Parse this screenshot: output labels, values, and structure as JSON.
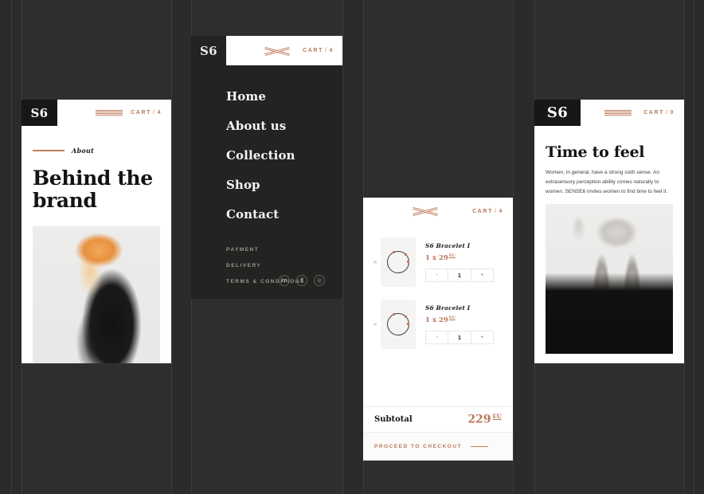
{
  "brand": {
    "logo": "S6",
    "name": "SENSE6"
  },
  "colors": {
    "copper": "#b9775a",
    "dark": "#232322",
    "logo_black": "#171716",
    "page_bg": "#2b2b2a"
  },
  "panel_about": {
    "logo": "S6",
    "hamburger_icon": "hamburger-icon",
    "cart_label": "CART",
    "cart_separator": "/",
    "cart_count": "4",
    "eyebrow": "About",
    "headline": "Behind the brand",
    "photo_alt": "woman-in-black-coat-photo"
  },
  "panel_menu": {
    "logo": "S6",
    "close_icon": "close-icon",
    "cart_label": "CART",
    "cart_separator": "/",
    "cart_count": "4",
    "nav": [
      {
        "label": "Home"
      },
      {
        "label": "About us"
      },
      {
        "label": "Collection"
      },
      {
        "label": "Shop"
      },
      {
        "label": "Contact"
      }
    ],
    "footer_links": [
      {
        "label": "PAYMENT"
      },
      {
        "label": "DELIVERY"
      },
      {
        "label": "TERMS & CONDITIONS"
      }
    ],
    "socials": [
      {
        "name": "linkedin-icon",
        "glyph": "in"
      },
      {
        "name": "facebook-icon",
        "glyph": "f"
      },
      {
        "name": "instagram-icon",
        "glyph": "◎"
      }
    ]
  },
  "panel_cart": {
    "close_icon": "close-icon",
    "cart_label": "CART",
    "cart_separator": "/",
    "cart_count": "4",
    "remove_glyph": "×",
    "items": [
      {
        "title": "S6 Bracelet I",
        "price_line": "1 x 29",
        "currency": "EU",
        "qty": "1",
        "minus": "-",
        "plus": "+",
        "thumb_alt": "bracelet-ring-thumbnail"
      },
      {
        "title": "S6 Bracelet I",
        "price_line": "1 x 29",
        "currency": "EU",
        "qty": "1",
        "minus": "-",
        "plus": "+",
        "thumb_alt": "bracelet-ring-thumbnail"
      }
    ],
    "subtotal_label": "Subtotal",
    "subtotal_value": "229",
    "subtotal_currency": "EU",
    "checkout_label": "PROCEED TO CHECKOUT"
  },
  "panel_home": {
    "logo": "S6",
    "hamburger_icon": "hamburger-icon",
    "cart_label": "CART",
    "cart_separator": "/",
    "cart_count": "0",
    "title": "Time to feel",
    "body": "Women, in general, have a strong sixth sense. An extrasensory perception ability comes naturally to women. SENSE6 invites women to find time to feel it.",
    "photo_alt": "black-and-white-portrait-long-hair"
  }
}
